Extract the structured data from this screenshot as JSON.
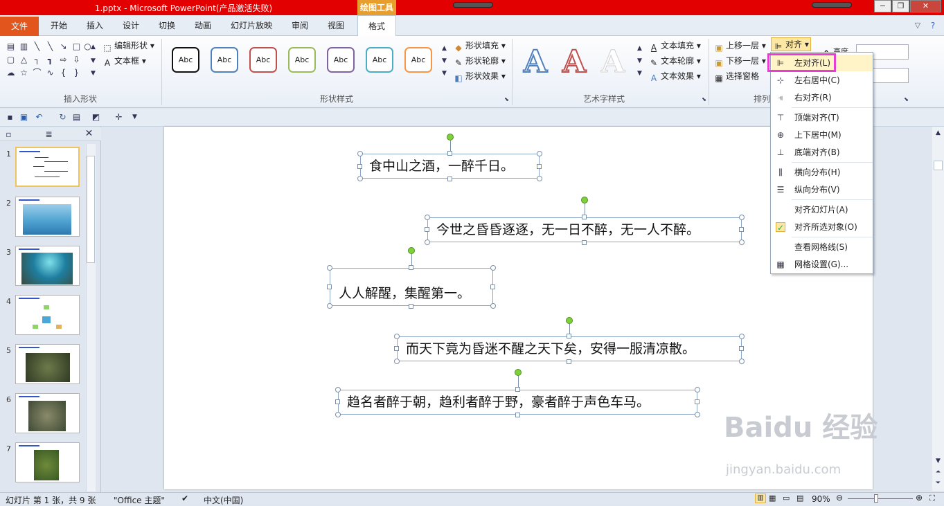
{
  "app": {
    "title": "1.pptx - Microsoft PowerPoint(产品激活失败)",
    "context_tab": "绘图工具",
    "window_buttons": [
      "−",
      "❐",
      "✕"
    ]
  },
  "tabs": [
    "文件",
    "开始",
    "插入",
    "设计",
    "切换",
    "动画",
    "幻灯片放映",
    "审阅",
    "视图",
    "格式"
  ],
  "ribbon": {
    "insert_shapes": {
      "label": "插入形状",
      "edit_shape": "编辑形状",
      "textbox": "文本框"
    },
    "shape_styles": {
      "label": "形状样式",
      "abc": "Abc",
      "fill": "形状填充",
      "outline": "形状轮廓",
      "effect": "形状效果"
    },
    "wordart": {
      "label": "艺术字样式",
      "letter": "A",
      "text_fill": "文本填充",
      "text_outline": "文本轮廓",
      "text_effect": "文本效果"
    },
    "arrange": {
      "label": "排列",
      "bring_forward": "上移一层",
      "send_backward": "下移一层",
      "selection_pane": "选择窗格",
      "align": "对齐"
    },
    "size": {
      "height_label": "高度"
    }
  },
  "align_menu": [
    {
      "label": "左对齐(L)",
      "icon": "align-left-icon"
    },
    {
      "label": "左右居中(C)",
      "icon": "align-center-icon"
    },
    {
      "label": "右对齐(R)",
      "icon": "align-right-icon"
    },
    {
      "label": "顶端对齐(T)",
      "icon": "align-top-icon"
    },
    {
      "label": "上下居中(M)",
      "icon": "align-middle-icon"
    },
    {
      "label": "底端对齐(B)",
      "icon": "align-bottom-icon"
    },
    {
      "label": "横向分布(H)",
      "icon": "distribute-horizontal-icon"
    },
    {
      "label": "纵向分布(V)",
      "icon": "distribute-vertical-icon"
    },
    {
      "label": "对齐幻灯片(A)",
      "icon": ""
    },
    {
      "label": "对齐所选对象(O)",
      "icon": "checkmark-icon",
      "checked": true
    },
    {
      "label": "查看网格线(S)",
      "icon": ""
    },
    {
      "label": "网格设置(G)...",
      "icon": "grid-icon"
    }
  ],
  "slide_panel": {
    "numbers": [
      "1",
      "2",
      "3",
      "4",
      "5",
      "6",
      "7"
    ]
  },
  "slide_texts": [
    "食中山之酒，一醉千日。",
    "今世之昏昏逐逐，无一日不醉，无一人不醉。",
    "人人解醒，集醒第一。",
    "而天下竟为昏迷不醒之天下矣，安得一服清凉散。",
    "趋名者醉于朝，趋利者醉于野，豪者醉于声色车马。"
  ],
  "status": {
    "slide_info": "幻灯片 第 1 张，共 9 张",
    "theme": "\"Office 主题\"",
    "language": "中文(中国)",
    "zoom": "90%"
  },
  "watermark": {
    "main": "Baidu 经验",
    "sub": "jingyan.baidu.com"
  },
  "colors": {
    "titlebar": "#e30000",
    "file_tab": "#e2561e",
    "highlight": "#e43fd0",
    "rotate_handle": "#7fd13b"
  }
}
